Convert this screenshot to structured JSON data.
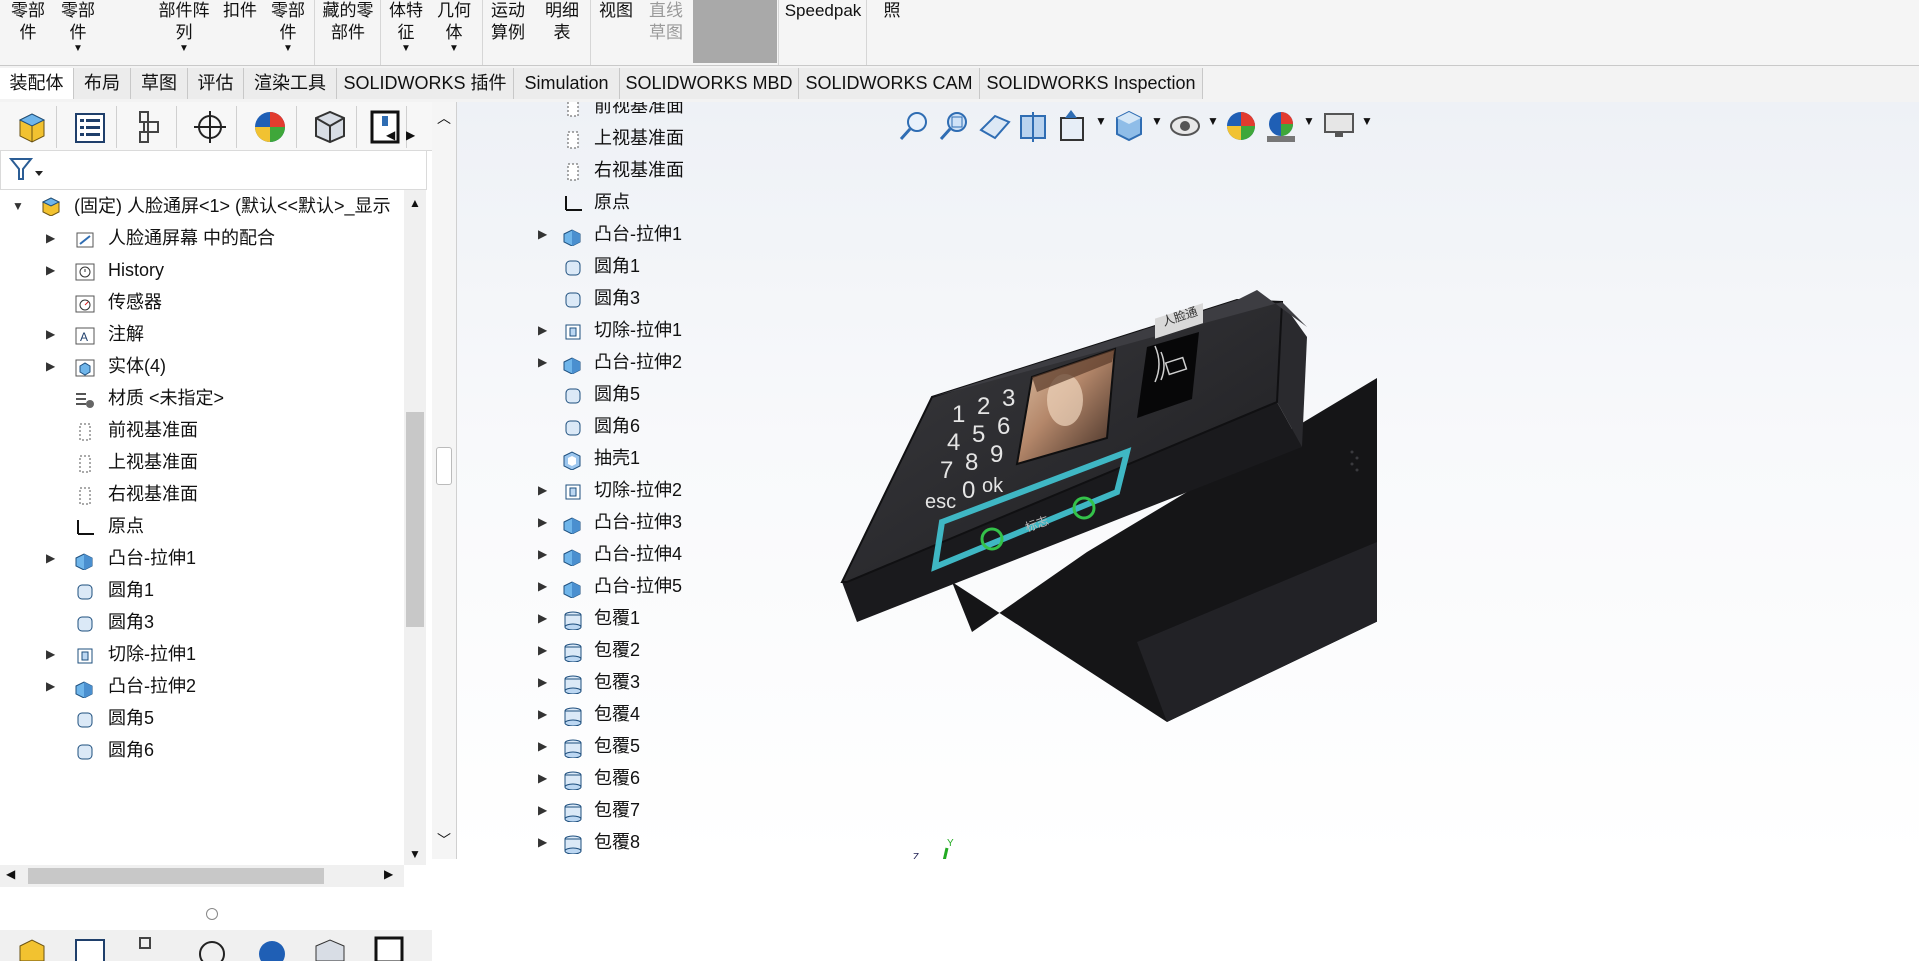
{
  "ribbon": {
    "items": [
      {
        "label": "零部\n件",
        "disabled": true
      },
      {
        "label": "零部\n件",
        "disabled": false,
        "caret": true
      },
      {
        "label": "部件阵\n列",
        "disabled": false,
        "caret": true
      },
      {
        "label": "扣件",
        "disabled": false
      },
      {
        "label": "零部\n件",
        "disabled": false,
        "caret": true
      },
      {
        "label": "藏的零\n部件",
        "disabled": false
      },
      {
        "label": "体特\n征",
        "disabled": false,
        "caret": true
      },
      {
        "label": "几何\n体",
        "disabled": false,
        "caret": true
      },
      {
        "label": "运动\n算例",
        "disabled": false
      },
      {
        "label": "明细\n表",
        "disabled": false
      },
      {
        "label": "视图",
        "disabled": false
      },
      {
        "label": "直线\n草图",
        "disabled": true
      },
      {
        "label": "Speedpak",
        "disabled": false
      },
      {
        "label": "照",
        "disabled": false
      }
    ]
  },
  "tabs": [
    {
      "label": "装配体",
      "active": true
    },
    {
      "label": "布局"
    },
    {
      "label": "草图"
    },
    {
      "label": "评估"
    },
    {
      "label": "渲染工具"
    },
    {
      "label": "SOLIDWORKS 插件"
    },
    {
      "label": "Simulation"
    },
    {
      "label": "SOLIDWORKS MBD"
    },
    {
      "label": "SOLIDWORKS CAM"
    },
    {
      "label": "SOLIDWORKS Inspection"
    }
  ],
  "panel_tabs": [
    "feature-manager",
    "property-manager",
    "configuration-manager",
    "dimxpert-manager",
    "display-manager",
    "cam-feature-tree",
    "cam-operation-tree"
  ],
  "tree": {
    "root": "(固定) 人脸通屏<1> (默认<<默认>_显示",
    "items": [
      {
        "label": "人脸通屏幕 中的配合",
        "expandable": true,
        "icon": "mates-icon"
      },
      {
        "label": "History",
        "expandable": true,
        "icon": "history-icon"
      },
      {
        "label": "传感器",
        "expandable": false,
        "icon": "sensor-icon"
      },
      {
        "label": "注解",
        "expandable": true,
        "icon": "annotation-icon"
      },
      {
        "label": "实体(4)",
        "expandable": true,
        "icon": "solid-bodies-icon"
      },
      {
        "label": "材质 <未指定>",
        "expandable": false,
        "icon": "material-icon"
      },
      {
        "label": "前视基准面",
        "expandable": false,
        "icon": "plane-icon"
      },
      {
        "label": "上视基准面",
        "expandable": false,
        "icon": "plane-icon"
      },
      {
        "label": "右视基准面",
        "expandable": false,
        "icon": "plane-icon"
      },
      {
        "label": "原点",
        "expandable": false,
        "icon": "origin-icon"
      },
      {
        "label": "凸台-拉伸1",
        "expandable": true,
        "icon": "extrude-icon"
      },
      {
        "label": "圆角1",
        "expandable": false,
        "icon": "fillet-icon"
      },
      {
        "label": "圆角3",
        "expandable": false,
        "icon": "fillet-icon"
      },
      {
        "label": "切除-拉伸1",
        "expandable": true,
        "icon": "cut-icon"
      },
      {
        "label": "凸台-拉伸2",
        "expandable": true,
        "icon": "extrude-icon"
      },
      {
        "label": "圆角5",
        "expandable": false,
        "icon": "fillet-icon"
      },
      {
        "label": "圆角6",
        "expandable": false,
        "icon": "fillet-icon"
      }
    ]
  },
  "flyout_tree": [
    {
      "label": "前视基准面",
      "expandable": false,
      "icon": "plane-icon"
    },
    {
      "label": "上视基准面",
      "expandable": false,
      "icon": "plane-icon"
    },
    {
      "label": "右视基准面",
      "expandable": false,
      "icon": "plane-icon"
    },
    {
      "label": "原点",
      "expandable": false,
      "icon": "origin-icon"
    },
    {
      "label": "凸台-拉伸1",
      "expandable": true,
      "icon": "extrude-icon"
    },
    {
      "label": "圆角1",
      "expandable": false,
      "icon": "fillet-icon"
    },
    {
      "label": "圆角3",
      "expandable": false,
      "icon": "fillet-icon"
    },
    {
      "label": "切除-拉伸1",
      "expandable": true,
      "icon": "cut-icon"
    },
    {
      "label": "凸台-拉伸2",
      "expandable": true,
      "icon": "extrude-icon"
    },
    {
      "label": "圆角5",
      "expandable": false,
      "icon": "fillet-icon"
    },
    {
      "label": "圆角6",
      "expandable": false,
      "icon": "fillet-icon"
    },
    {
      "label": "抽壳1",
      "expandable": false,
      "icon": "shell-icon"
    },
    {
      "label": "切除-拉伸2",
      "expandable": true,
      "icon": "cut-icon"
    },
    {
      "label": "凸台-拉伸3",
      "expandable": true,
      "icon": "extrude-icon"
    },
    {
      "label": "凸台-拉伸4",
      "expandable": true,
      "icon": "extrude-icon"
    },
    {
      "label": "凸台-拉伸5",
      "expandable": true,
      "icon": "extrude-icon"
    },
    {
      "label": "包覆1",
      "expandable": true,
      "icon": "wrap-icon"
    },
    {
      "label": "包覆2",
      "expandable": true,
      "icon": "wrap-icon"
    },
    {
      "label": "包覆3",
      "expandable": true,
      "icon": "wrap-icon"
    },
    {
      "label": "包覆4",
      "expandable": true,
      "icon": "wrap-icon"
    },
    {
      "label": "包覆5",
      "expandable": true,
      "icon": "wrap-icon"
    },
    {
      "label": "包覆6",
      "expandable": true,
      "icon": "wrap-icon"
    },
    {
      "label": "包覆7",
      "expandable": true,
      "icon": "wrap-icon"
    },
    {
      "label": "包覆8",
      "expandable": true,
      "icon": "wrap-icon"
    }
  ],
  "model": {
    "keypad": [
      "1",
      "2",
      "3",
      "4",
      "5",
      "6",
      "7",
      "8",
      "9",
      "esc",
      "0",
      "ok"
    ],
    "bottom_label": "标志",
    "tag_label": "人脸通"
  },
  "triad": {
    "x": "X",
    "y": "Y",
    "z": "Z"
  },
  "colors": {
    "accent_blue": "#2f6db3",
    "teal_frame": "#3fb7c4",
    "green_button": "#34c24a",
    "device_body": "#2b2b2e"
  }
}
